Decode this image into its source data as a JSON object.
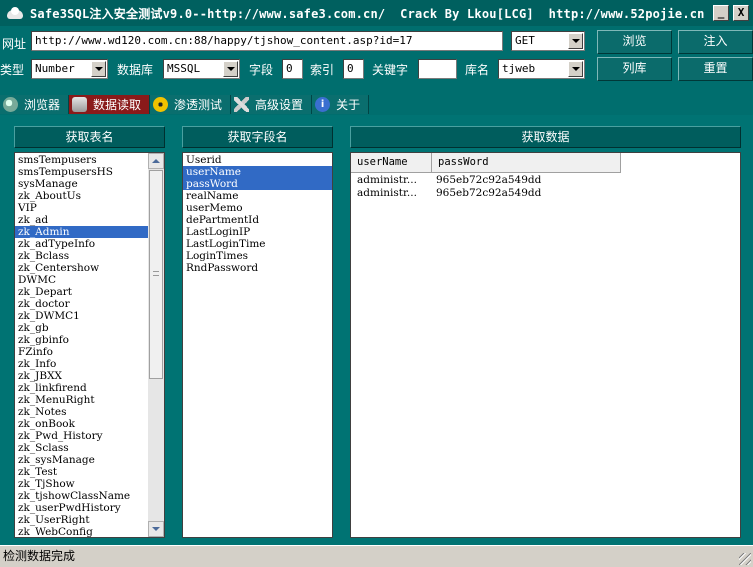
{
  "window": {
    "title": "Safe3SQL注入安全测试v9.0--http://www.safe3.com.cn/  Crack By Lkou[LCG]  http://www.52pojie.cn",
    "minimize_label": "_",
    "close_label": "X"
  },
  "form": {
    "url_label": "网址",
    "url_value": "http://www.wd120.com.cn:88/happy/tjshow_content.asp?id=17",
    "method_value": "GET",
    "browse_label": "浏览",
    "inject_label": "注入",
    "type_label": "类型",
    "type_value": "Number",
    "db_label": "数据库",
    "db_value": "MSSQL",
    "field_label": "字段",
    "field_value": "0",
    "index_label": "索引",
    "index_value": "0",
    "keyword_label": "关键字",
    "keyword_value": "",
    "table_label": "库名",
    "table_value": "tjweb",
    "list_db_label": "列库",
    "reset_label": "重置"
  },
  "tabs": [
    {
      "label": "浏览器",
      "active": false
    },
    {
      "label": "数据读取",
      "active": true
    },
    {
      "label": "渗透测试",
      "active": false
    },
    {
      "label": "高级设置",
      "active": false
    },
    {
      "label": "关于",
      "active": false
    }
  ],
  "tables_panel": {
    "header": "获取表名",
    "items": [
      "smsTempusers",
      "smsTempusersHS",
      "sysManage",
      "zk_AboutUs",
      "VIP",
      "zk_ad",
      "zk_Admin",
      "zk_adTypeInfo",
      "zk_Bclass",
      "zk_Centershow",
      "DWMC",
      "zk_Depart",
      "zk_doctor",
      "zk_DWMC1",
      "zk_gb",
      "zk_gbinfo",
      "FZinfo",
      "zk_Info",
      "zk_JBXX",
      "zk_linkfirend",
      "zk_MenuRight",
      "zk_Notes",
      "zk_onBook",
      "zk_Pwd_History",
      "zk_Sclass",
      "zk_sysManage",
      "zk_Test",
      "zk_TjShow",
      "zk_tjshowClassName",
      "zk_userPwdHistory",
      "zk_UserRight",
      "zk_WebConfig"
    ],
    "selected": "zk_Admin"
  },
  "fields_panel": {
    "header": "获取字段名",
    "items": [
      "Userid",
      "userName",
      "passWord",
      "realName",
      "userMemo",
      "dePartmentId",
      "LastLoginIP",
      "LastLoginTime",
      "LoginTimes",
      "RndPassword"
    ],
    "selected": [
      "userName",
      "passWord"
    ]
  },
  "data_panel": {
    "header": "获取数据",
    "columns": [
      "userName",
      "passWord"
    ],
    "rows": [
      [
        "administr...",
        "965eb72c92a549dd"
      ],
      [
        "administr...",
        "965eb72c92a549dd"
      ]
    ]
  },
  "status": {
    "text": "检测数据完成"
  }
}
